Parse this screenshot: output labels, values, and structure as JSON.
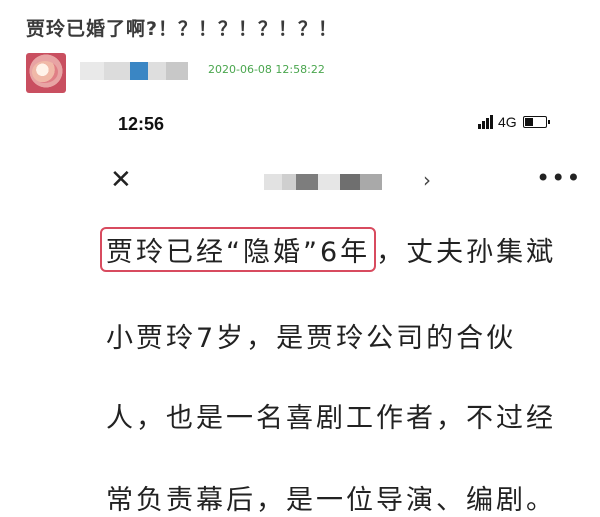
{
  "post": {
    "title": "贾玲已婚了啊?！？！？！？！？！",
    "date": "2020-06-08 12:58:22"
  },
  "phone": {
    "time": "12:56",
    "network": "4G"
  },
  "article": {
    "highlight_text": "贾玲已经“隐婚”6年",
    "line1_rest": "，丈夫孙集斌",
    "line2": "小贾玲7岁，是贾玲公司的合伙",
    "line3": "人，也是一名喜剧工作者，不过经",
    "line4": "常负责幕后，是一位导演、编剧。"
  },
  "icons": {
    "close": "close-icon",
    "chevron": "chevron-right-icon",
    "more": "more-icon"
  }
}
